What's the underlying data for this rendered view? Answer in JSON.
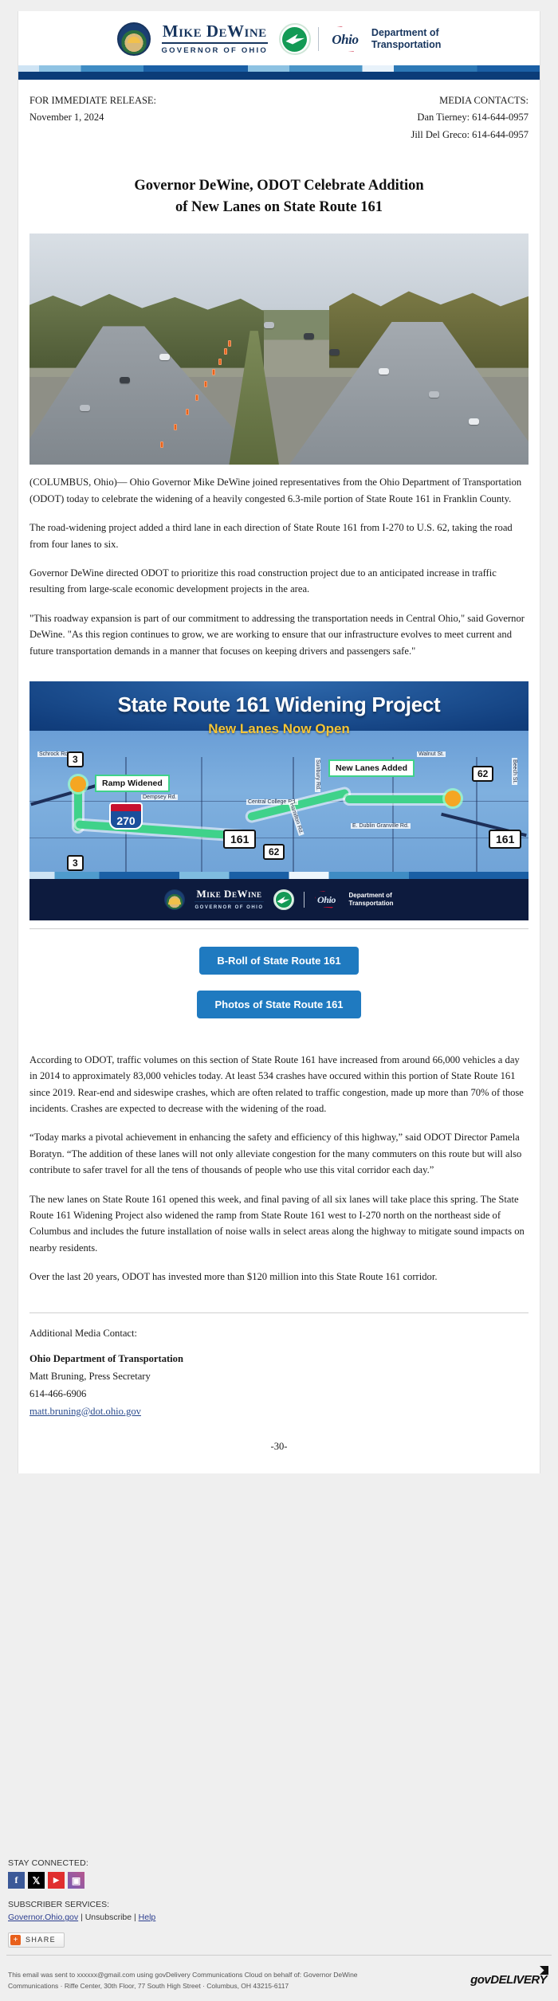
{
  "masthead": {
    "governor_name": "Mike DeWine",
    "governor_subtitle": "GOVERNOR OF OHIO",
    "ohio_word": "Ohio",
    "agency_line1": "Department of",
    "agency_line2": "Transportation"
  },
  "release": {
    "immediate_label": "FOR IMMEDIATE RELEASE:",
    "date": "November 1, 2024",
    "media_contacts_label": "MEDIA CONTACTS:",
    "contact_1": "Dan Tierney: 614-644-0957",
    "contact_2": "Jill Del Greco: 614-644-0957"
  },
  "headline": {
    "line1": "Governor DeWine, ODOT Celebrate Addition",
    "line2": "of New Lanes on State Route 161"
  },
  "body": {
    "p1": "(COLUMBUS, Ohio)— Ohio Governor Mike DeWine joined representatives from the Ohio Department of Transportation (ODOT) today to celebrate the widening of a heavily congested 6.3-mile portion of State Route 161 in Franklin County.",
    "p2": "The road-widening project added a third lane in each direction of State Route 161 from I-270 to U.S. 62, taking the road from four lanes to six.",
    "p3": "Governor DeWine directed ODOT to prioritize this road construction project due to an anticipated increase in traffic resulting from large-scale economic development projects in the area.",
    "p4": "\"This roadway expansion is part of our commitment to addressing the transportation needs in Central Ohio,\" said Governor DeWine. \"As this region continues to grow, we are working to ensure that our infrastructure evolves to meet current and future transportation demands in a manner that focuses on keeping drivers and passengers safe.\"",
    "p5": "According to ODOT, traffic volumes on this section of State Route 161 have increased from around 66,000 vehicles a day in 2014 to approximately 83,000 vehicles today.  At least 534 crashes have occured within this portion of State Route 161 since 2019. Rear-end and sideswipe crashes, which are often related to traffic congestion, made up more than 70% of those incidents. Crashes are expected to decrease with the widening of the road.",
    "p6": "“Today marks a pivotal achievement in enhancing the safety and efficiency of this highway,” said ODOT Director Pamela Boratyn. “The addition of these lanes will not only alleviate congestion for the many commuters on this route but will also contribute to safer travel for all the tens of thousands of people who use this vital corridor each day.”",
    "p7": "The new lanes on State Route 161 opened this week, and final paving of all six lanes will take place this spring. The State Route 161 Widening Project also widened the ramp from State Route 161 west to I-270 north on the northeast side of Columbus and includes the future installation of noise walls in select areas along the highway to mitigate sound impacts on nearby residents.",
    "p8": "Over the last 20 years, ODOT has invested more than $120 million into this State Route 161 corridor."
  },
  "map": {
    "title": "State Route 161 Widening Project",
    "subtitle": "New Lanes Now Open",
    "callout_ramp": "Ramp Widened",
    "callout_lanes": "New Lanes Added",
    "shield_3_left": "3",
    "shield_3_bottom": "3",
    "shield_62_top": "62",
    "shield_62_mid": "62",
    "shield_161_center": "161",
    "shield_161_right": "161",
    "shield_270": "270",
    "street_schrock": "Schrock Rd.",
    "street_walnut": "Walnut St.",
    "street_central_college": "Central College Rd.",
    "street_dempsey": "Dempsey Rd.",
    "street_hamilton": "Hamilton Rd.",
    "street_dublin_granville": "E. Dublin Granville Rd.",
    "street_sunbury": "Sunbury Rd.",
    "street_beech": "Beech St.",
    "footer_gov": "Mike DeWine",
    "footer_gov_sub": "GOVERNOR OF OHIO",
    "footer_agency1": "Department of",
    "footer_agency2": "Transportation",
    "footer_ohio": "Ohio"
  },
  "cta": {
    "broll": "B-Roll of State Route 161",
    "photos": "Photos of State Route 161"
  },
  "additional_contact": {
    "heading": "Additional Media Contact:",
    "org": "Ohio Department of Transportation",
    "person": "Matt Bruning, Press Secretary",
    "phone": "614-466-6906",
    "email": "matt.bruning@dot.ohio.gov",
    "end_mark": "-30-"
  },
  "footer": {
    "stay_connected": "STAY CONNECTED:",
    "social": [
      {
        "name": "facebook-icon",
        "glyph": "f"
      },
      {
        "name": "x-twitter-icon",
        "glyph": "𝕏"
      },
      {
        "name": "youtube-icon",
        "glyph": "▶"
      },
      {
        "name": "instagram-icon",
        "glyph": "▣"
      }
    ],
    "subscriber_label": "SUBSCRIBER SERVICES:",
    "link_site": "Governor.Ohio.gov",
    "sep1": "|",
    "link_unsubscribe": "Unsubscribe",
    "sep2": "|",
    "link_help": "Help",
    "share_label": "SHARE",
    "share_plus": "+",
    "legal_line1": "This email was sent to xxxxxx@gmail.com using govDelivery Communications Cloud on behalf of: Governor DeWine",
    "legal_line2": "Communications · Riffe Center, 30th Floor, 77 South High Street · Columbus, OH 43215-6117",
    "govdelivery": "govDELIVERY"
  },
  "colors": {
    "navy": "#17355e",
    "odot_green": "#139a55",
    "ohio_red": "#c8102e",
    "button_blue": "#1f7ac0",
    "ribbon_dark": "#0b3c78",
    "map_highlight": "#3fd28a"
  }
}
